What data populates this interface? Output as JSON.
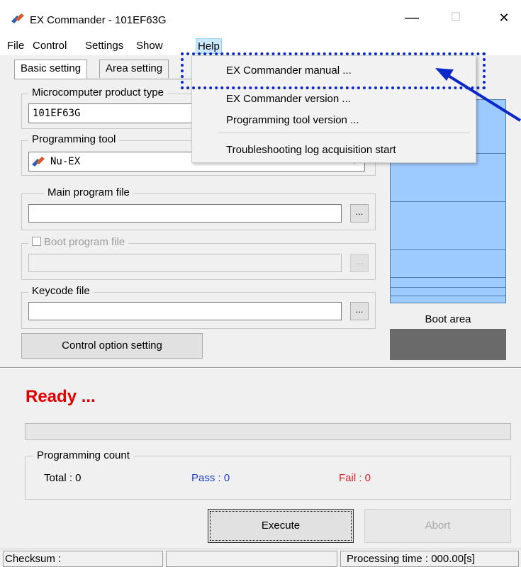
{
  "window": {
    "title": "EX Commander - 101EF63G",
    "controls": {
      "minimize": "—",
      "maximize": "☐",
      "close": "✕"
    }
  },
  "menu": [
    "File",
    "Control",
    "Settings",
    "Show",
    "Help"
  ],
  "tabs": [
    "Basic setting",
    "Area setting"
  ],
  "micro": {
    "label": "Microcomputer product type",
    "value": "101EF63G"
  },
  "tool": {
    "label": "Programming tool",
    "value": "Nu-EX",
    "dropdown_glyph": "▾"
  },
  "main_program": {
    "label": "Main program file",
    "value": "",
    "browse": "..."
  },
  "boot_program": {
    "label": "Boot program file",
    "value": "",
    "browse": "...",
    "checked": false
  },
  "keycode": {
    "label": "Keycode file",
    "value": "",
    "browse": "..."
  },
  "control_option_button": "Control option setting",
  "area_map": {
    "boot_label": "Boot area",
    "fill_color": "#9ecbff",
    "boot_color": "#6a6a6a"
  },
  "status": {
    "text": "Ready ...",
    "color": "#e00000"
  },
  "programming_count": {
    "label": "Programming count",
    "total": "Total : 0",
    "pass": "Pass : 0",
    "fail": "Fail : 0",
    "pass_color": "#2040d0",
    "fail_color": "#e02020"
  },
  "buttons": {
    "execute": "Execute",
    "abort": "Abort"
  },
  "statusbar": {
    "checksum": "Checksum :",
    "middle": "",
    "processing_time": "Processing time : 000.00[s]"
  },
  "help_menu": {
    "items": [
      "EX Commander manual ...",
      "EX Commander version ...",
      "Programming tool version ...",
      "Troubleshooting log acquisition start"
    ],
    "highlight_color": "#0a28c8"
  }
}
